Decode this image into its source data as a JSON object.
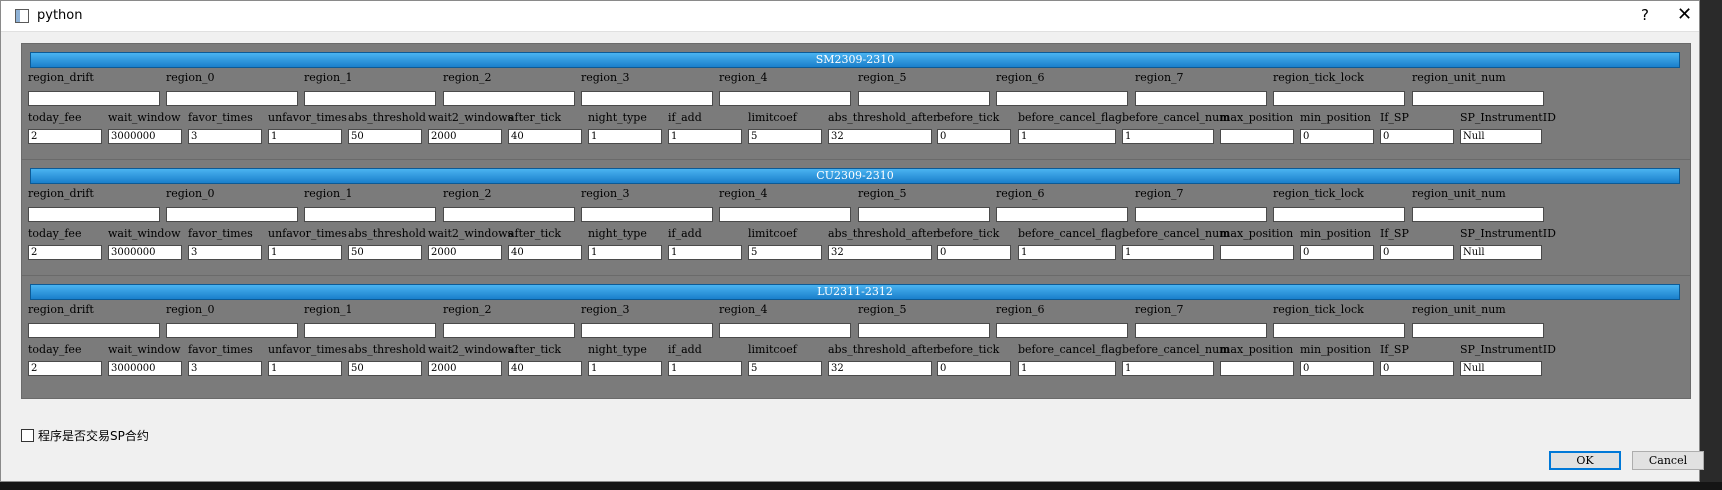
{
  "window": {
    "title": "python",
    "help_label": "?",
    "close_label": "✕"
  },
  "groups": [
    {
      "header": "SM2309-2310",
      "row1_labels": [
        "region_drift",
        "region_0",
        "region_1",
        "region_2",
        "region_3",
        "region_4",
        "region_5",
        "region_6",
        "region_7",
        "region_tick_lock",
        "region_unit_num"
      ],
      "row1_values": [
        "",
        "",
        "",
        "",
        "",
        "",
        "",
        "",
        "",
        "",
        ""
      ],
      "row2_labels": [
        "today_fee",
        "wait_window",
        "favor_times",
        "unfavor_times",
        "abs_threshold",
        "wait2_windows",
        "after_tick",
        "night_type",
        "if_add",
        "limitcoef",
        "abs_threshold_after",
        "before_tick",
        "before_cancel_flag",
        "before_cancel_num",
        "max_position",
        "min_position",
        "If_SP",
        "SP_InstrumentID"
      ],
      "row2_values": [
        "2",
        "3000000",
        "3",
        "1",
        "50",
        "2000",
        "40",
        "1",
        "1",
        "5",
        "32",
        "0",
        "1",
        "1",
        "",
        "0",
        "0",
        "Null"
      ]
    },
    {
      "header": "CU2309-2310",
      "row1_labels": [
        "region_drift",
        "region_0",
        "region_1",
        "region_2",
        "region_3",
        "region_4",
        "region_5",
        "region_6",
        "region_7",
        "region_tick_lock",
        "region_unit_num"
      ],
      "row1_values": [
        "",
        "",
        "",
        "",
        "",
        "",
        "",
        "",
        "",
        "",
        ""
      ],
      "row2_labels": [
        "today_fee",
        "wait_window",
        "favor_times",
        "unfavor_times",
        "abs_threshold",
        "wait2_windows",
        "after_tick",
        "night_type",
        "if_add",
        "limitcoef",
        "abs_threshold_after",
        "before_tick",
        "before_cancel_flag",
        "before_cancel_num",
        "max_position",
        "min_position",
        "If_SP",
        "SP_InstrumentID"
      ],
      "row2_values": [
        "2",
        "3000000",
        "3",
        "1",
        "50",
        "2000",
        "40",
        "1",
        "1",
        "5",
        "32",
        "0",
        "1",
        "1",
        "",
        "0",
        "0",
        "Null"
      ]
    },
    {
      "header": "LU2311-2312",
      "row1_labels": [
        "region_drift",
        "region_0",
        "region_1",
        "region_2",
        "region_3",
        "region_4",
        "region_5",
        "region_6",
        "region_7",
        "region_tick_lock",
        "region_unit_num"
      ],
      "row1_values": [
        "",
        "",
        "",
        "",
        "",
        "",
        "",
        "",
        "",
        "",
        ""
      ],
      "row2_labels": [
        "today_fee",
        "wait_window",
        "favor_times",
        "unfavor_times",
        "abs_threshold",
        "wait2_windows",
        "after_tick",
        "night_type",
        "if_add",
        "limitcoef",
        "abs_threshold_after",
        "before_tick",
        "before_cancel_flag",
        "before_cancel_num",
        "max_position",
        "min_position",
        "If_SP",
        "SP_InstrumentID"
      ],
      "row2_values": [
        "2",
        "3000000",
        "3",
        "1",
        "50",
        "2000",
        "40",
        "1",
        "1",
        "5",
        "32",
        "0",
        "1",
        "1",
        "",
        "0",
        "0",
        "Null"
      ]
    }
  ],
  "sp_checkbox": {
    "label": "程序是否交易SP合约",
    "checked": false
  },
  "buttons": {
    "ok": "OK",
    "cancel": "Cancel"
  }
}
